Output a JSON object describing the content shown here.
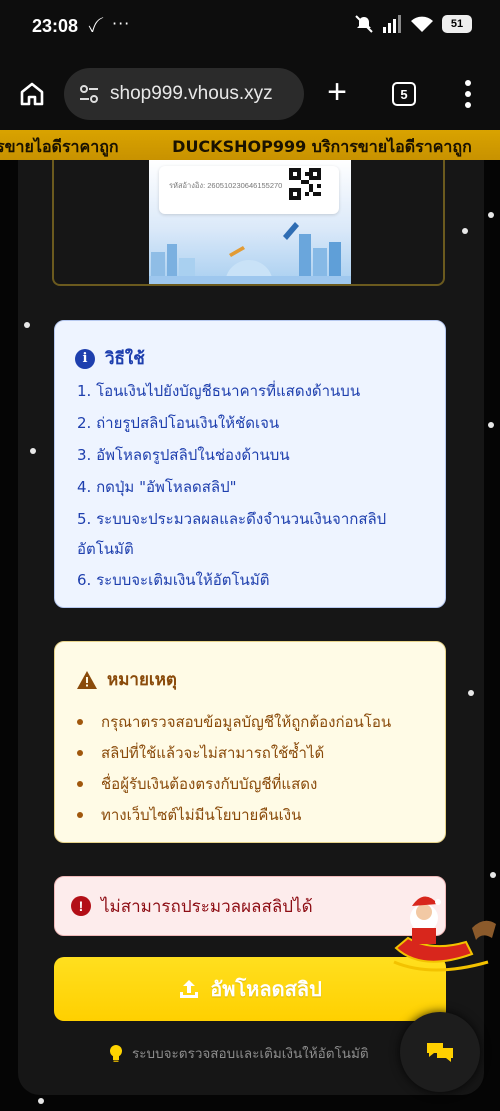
{
  "status_bar": {
    "time": "23:08",
    "carrier_badge": "ꪜ",
    "overflow": "···",
    "battery": "51"
  },
  "browser": {
    "url": "shop999.vhous.xyz",
    "tab_count": "5"
  },
  "marquee": {
    "segments": [
      "รขายไอดีราคาถูก",
      "DUCKSHOP999 บริการขายไอดีราคาถูก"
    ]
  },
  "slip": {
    "reference": "รหัสอ้างอิง: 260510230646155270"
  },
  "instructions": {
    "title": "วิธีใช้",
    "steps": [
      "1. โอนเงินไปยังบัญชีธนาคารที่แสดงด้านบน",
      "2. ถ่ายรูปสลิปโอนเงินให้ชัดเจน",
      "3. อัพโหลดรูปสลิปในช่องด้านบน",
      "4. กดปุ่ม \"อัพโหลดสลิป\"",
      "5. ระบบจะประมวลผลและดึงจำนวนเงินจากสลิปอัตโนมัติ",
      "6. ระบบจะเติมเงินให้อัตโนมัติ"
    ]
  },
  "notes": {
    "title": "หมายเหตุ",
    "items": [
      "กรุณาตรวจสอบข้อมูลบัญชีให้ถูกต้องก่อนโอน",
      "สลิปที่ใช้แล้วจะไม่สามารถใช้ซ้ำได้",
      "ชื่อผู้รับเงินต้องตรงกับบัญชีที่แสดง",
      "ทางเว็บไซต์ไม่มีนโยบายคืนเงิน"
    ]
  },
  "error": {
    "message": "ไม่สามารถประมวลผลสลิปได้"
  },
  "upload": {
    "label": "อัพโหลดสลิป"
  },
  "hint": {
    "text": "ระบบจะตรวจสอบและเติมเงินให้อัตโนมัติ"
  },
  "colors": {
    "accent_gold": "#d9a300",
    "instr_blue": "#1e3fae",
    "notes_brown": "#8a4b0b",
    "error_red": "#b30f17",
    "button_yellow": "#ffd000"
  }
}
